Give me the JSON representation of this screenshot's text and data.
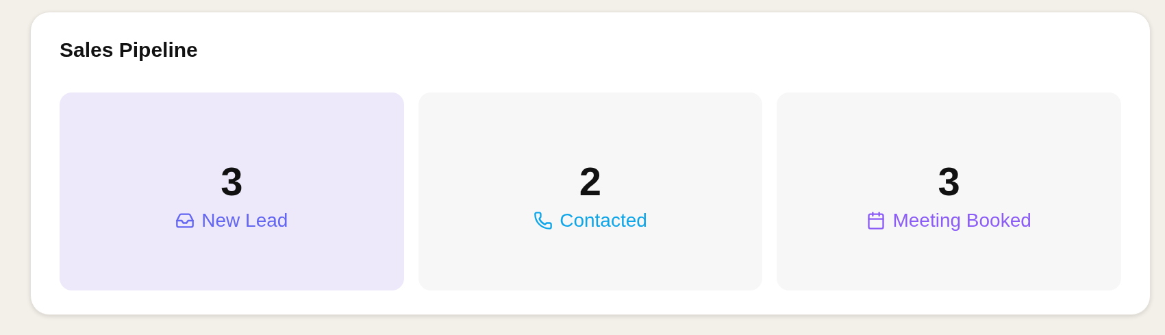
{
  "title": "Sales Pipeline",
  "stages": [
    {
      "count": "3",
      "label": "New Lead",
      "kind": "inbox",
      "color": "#6366f1",
      "selected": true
    },
    {
      "count": "2",
      "label": "Contacted",
      "kind": "phone",
      "color": "#0ea5e9",
      "selected": false
    },
    {
      "count": "3",
      "label": "Meeting Booked",
      "kind": "calendar",
      "color": "#8b5cf6",
      "selected": false
    }
  ]
}
